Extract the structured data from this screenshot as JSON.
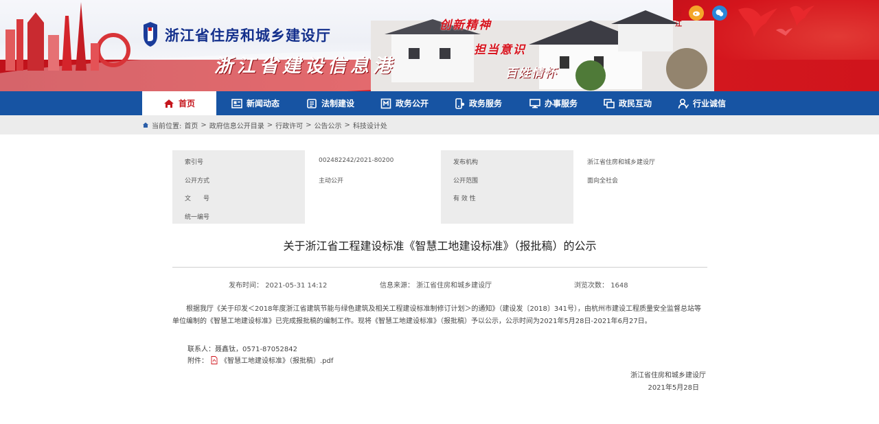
{
  "header": {
    "site_title": "浙江省住房和城乡建设厅",
    "site_subtitle": "浙江省建设信息港",
    "slogans": [
      "创新精神",
      "担当意识",
      "百姓情怀"
    ],
    "top_link": "浙江",
    "brand_red": "#d0141c",
    "brand_blue": "#1754a3"
  },
  "nav": {
    "items": [
      {
        "label": "首页",
        "icon": "home-icon"
      },
      {
        "label": "新闻动态",
        "icon": "news-icon"
      },
      {
        "label": "法制建设",
        "icon": "law-icon"
      },
      {
        "label": "政务公开",
        "icon": "gov-open-icon"
      },
      {
        "label": "政务服务",
        "icon": "gov-service-icon"
      },
      {
        "label": "办事服务",
        "icon": "affairs-icon"
      },
      {
        "label": "政民互动",
        "icon": "interaction-icon"
      },
      {
        "label": "行业诚信",
        "icon": "credit-icon"
      }
    ]
  },
  "breadcrumb": {
    "prefix": "当前位置:",
    "items": [
      "首页",
      "政府信息公开目录",
      "行政许可",
      "公告公示",
      "科技设计处"
    ]
  },
  "info": {
    "left_labels": [
      "索引号",
      "公开方式",
      "文　　号",
      "统一编号"
    ],
    "left_values": [
      "002482242/2021-80200",
      "主动公开",
      "",
      ""
    ],
    "right_labels": [
      "发布机构",
      "公开范围",
      "有 效 性"
    ],
    "right_values": [
      "浙江省住房和城乡建设厅",
      "面向全社会",
      ""
    ]
  },
  "article": {
    "title": "关于浙江省工程建设标准《智慧工地建设标准》（报批稿）的公示",
    "publish_label": "发布时间：",
    "publish_time": "2021-05-31 14:12",
    "source_label": "信息来源：",
    "source": "浙江省住房和城乡建设厅",
    "views_label": "浏览次数：",
    "views": "1648",
    "paragraph": "根据我厅《关于印发＜2018年度浙江省建筑节能与绿色建筑及相关工程建设标准制修订计划＞的通知》（建设发〔2018〕341号），由杭州市建设工程质量安全监督总站等单位编制的《智慧工地建设标准》已完成报批稿的编制工作。现将《智慧工地建设标准》（报批稿）予以公示，公示时间为2021年5月28日-2021年6月27日。",
    "contact": "联系人：聂鑫钛，0571-87052842",
    "attach_label": "附件：",
    "attach_file": "《智慧工地建设标准》（报批稿）.pdf",
    "sign_org": "浙江省住房和城乡建设厅",
    "sign_date": "2021年5月28日"
  }
}
